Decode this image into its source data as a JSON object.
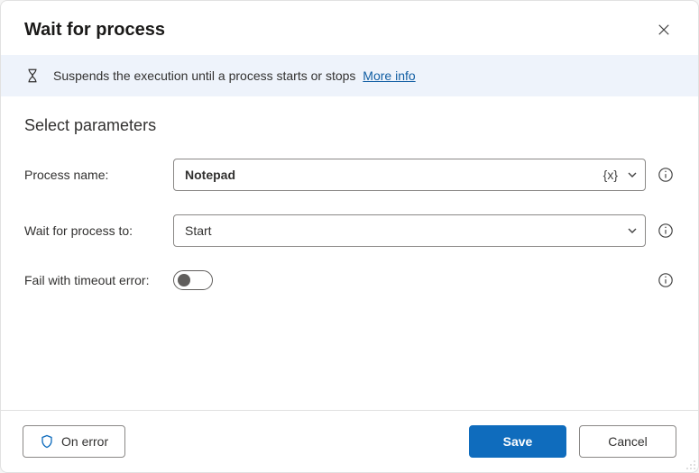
{
  "header": {
    "title": "Wait for process"
  },
  "banner": {
    "text": "Suspends the execution until a process starts or stops",
    "link": "More info"
  },
  "section": {
    "title": "Select parameters"
  },
  "fields": {
    "process_name": {
      "label": "Process name:",
      "value": "Notepad",
      "var_token": "{x}"
    },
    "wait_for": {
      "label": "Wait for process to:",
      "value": "Start"
    },
    "fail_timeout": {
      "label": "Fail with timeout error:"
    }
  },
  "footer": {
    "on_error": "On error",
    "save": "Save",
    "cancel": "Cancel"
  }
}
